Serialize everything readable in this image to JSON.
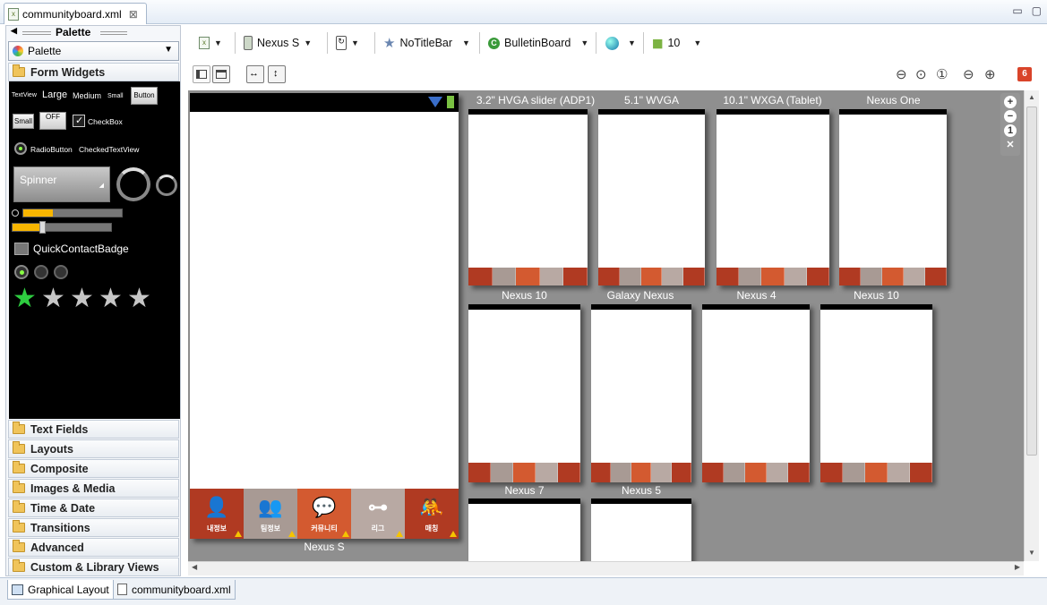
{
  "editor_tab": {
    "title": "communityboard.xml",
    "close": "⊠"
  },
  "window_controls": {
    "minimize": "▭",
    "maximize": "▢"
  },
  "palette": {
    "header": "Palette",
    "select_value": "Palette",
    "categories_top": [
      "Form Widgets"
    ],
    "widgets": {
      "textview_small": "TextView",
      "large": "Large",
      "medium": "Medium",
      "small": "Small",
      "button": "Button",
      "small_button": "Small",
      "toggle": "OFF",
      "checkbox": "CheckBox",
      "radio": "RadioButton",
      "checked_text": "CheckedTextView",
      "spinner": "Spinner",
      "quick_contact": "QuickContactBadge",
      "rating_stars": 5,
      "rating_value": 1
    },
    "categories": [
      "Text Fields",
      "Layouts",
      "Composite",
      "Images & Media",
      "Time & Date",
      "Transitions",
      "Advanced",
      "Custom & Library Views"
    ]
  },
  "toolbar": {
    "device": "Nexus S",
    "theme": "NoTitleBar",
    "activity": "BulletinBoard",
    "api": "10"
  },
  "error_count": "6",
  "canvas": {
    "main_device_label": "Nexus S",
    "main_nav": [
      "내정보",
      "팀정보",
      "커뮤니티",
      "리그",
      "매칭"
    ],
    "preview_row1_titles": [
      "3.2\" HVGA slider (ADP1)",
      "5.1\" WVGA",
      "10.1\" WXGA (Tablet)",
      "Nexus One"
    ],
    "preview_row1_labels": [
      "Nexus 10",
      "Galaxy Nexus",
      "Nexus 4",
      "Nexus 10"
    ],
    "preview_row2_labels": [
      "Nexus 7",
      "Nexus 5"
    ],
    "zoom_controls": [
      "+",
      "−",
      "1",
      "✕"
    ]
  },
  "colors": {
    "nav_red": "#b03020",
    "nav_orange": "#d85a30",
    "nav_grey": "#9a9a9a",
    "canvas_bg": "#8f8f8f",
    "accent_yellow": "#f7b500"
  },
  "bottom_tabs": [
    "Graphical Layout",
    "communityboard.xml"
  ]
}
